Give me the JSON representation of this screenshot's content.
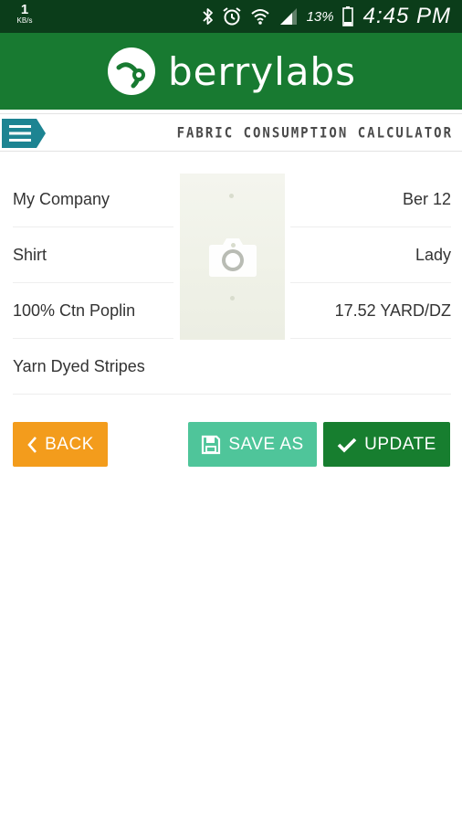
{
  "status_bar": {
    "net_speed_value": "1",
    "net_speed_unit": "KB/s",
    "battery_percent": "13%",
    "time": "4:45 PM",
    "icons": [
      "bluetooth-icon",
      "alarm-icon",
      "wifi-icon",
      "signal-icon",
      "battery-icon"
    ]
  },
  "header": {
    "brand": "berrylabs",
    "logo_icon": "berrylabs-logo-icon",
    "background": "#187a31"
  },
  "title_bar": {
    "title": "FABRIC CONSUMPTION CALCULATOR",
    "menu_icon": "hamburger-menu-icon"
  },
  "details": {
    "left": [
      "My Company",
      "Shirt",
      "100% Ctn Poplin",
      "Yarn Dyed Stripes"
    ],
    "right": [
      "Ber 12",
      "Lady",
      "17.52 YARD/DZ"
    ]
  },
  "photo": {
    "icon": "camera-icon"
  },
  "buttons": {
    "back": "BACK",
    "save_as": "SAVE AS",
    "update": "UPDATE"
  },
  "colors": {
    "status_bar": "#0b3d1a",
    "header": "#187a31",
    "back": "#f39c1c",
    "save_as": "#4fc59a",
    "update": "#177e2f",
    "menu": "#1d8492"
  }
}
